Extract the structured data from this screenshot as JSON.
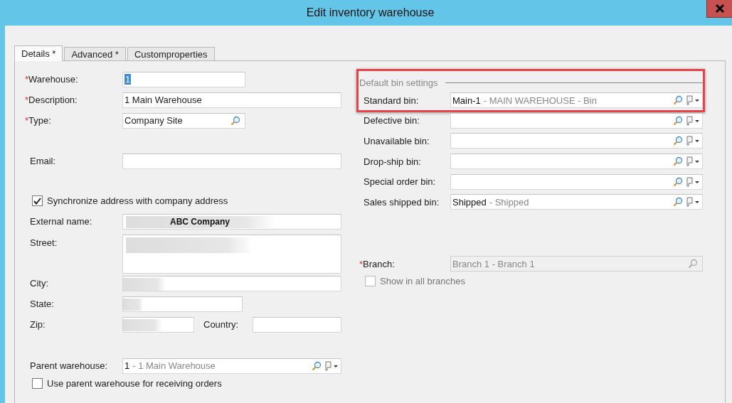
{
  "window": {
    "title": "Edit inventory warehouse"
  },
  "tabs": [
    {
      "label": "Details *",
      "selected": true
    },
    {
      "label": "Advanced *",
      "selected": false
    },
    {
      "label": "Customproperties",
      "selected": false
    }
  ],
  "general": [
    {
      "label": "Warehouse:",
      "required_mark": "*",
      "kind": "text",
      "value": "1",
      "value_selected": true
    },
    {
      "label": "Description:",
      "required_mark": "*",
      "kind": "text",
      "value": "1 Main Warehouse",
      "value_selected": false
    },
    {
      "label": "Type:",
      "required_mark": "*",
      "kind": "lookup",
      "value": "Company Site",
      "value_selected": false
    }
  ],
  "email": {
    "label": "Email:"
  },
  "address": {
    "sync": {
      "label": "Synchronize address with company address",
      "checked": true
    },
    "fields": [
      {
        "label": "External name:",
        "kind": "text",
        "value": "ABC Company",
        "redacted": true
      },
      {
        "label": "Street:",
        "kind": "textarea",
        "redacted": true
      },
      {
        "label": "City:",
        "kind": "text",
        "redacted": true
      },
      {
        "label": "State:",
        "kind": "text",
        "redacted": true
      },
      {
        "label": "Zip:",
        "kind": "zip",
        "redacted": true,
        "second_label": "Country:"
      }
    ]
  },
  "parent": {
    "label": "Parent warehouse:",
    "code": "1",
    "description": "- 1 Main Warehouse",
    "receiving": {
      "label": "Use parent warehouse for receiving orders",
      "checked": false
    }
  },
  "bins": {
    "title": "Default bin settings",
    "highlighted": true,
    "rows": [
      {
        "label": "Standard bin:",
        "code": "Main-1",
        "description": "- MAIN WAREHOUSE - Bin"
      },
      {
        "label": "Defective bin:"
      },
      {
        "label": "Unavailable bin:"
      },
      {
        "label": "Drop-ship bin:"
      },
      {
        "label": "Special order bin:"
      },
      {
        "label": "Sales shipped bin:",
        "code": "Shipped",
        "description": "- Shipped"
      }
    ]
  },
  "branch": {
    "label": "Branch:",
    "required_mark": "*",
    "value": "Branch 1 - Branch 1",
    "disabled": true,
    "show_all": {
      "label": "Show in all branches",
      "checked": false,
      "disabled": true
    }
  }
}
